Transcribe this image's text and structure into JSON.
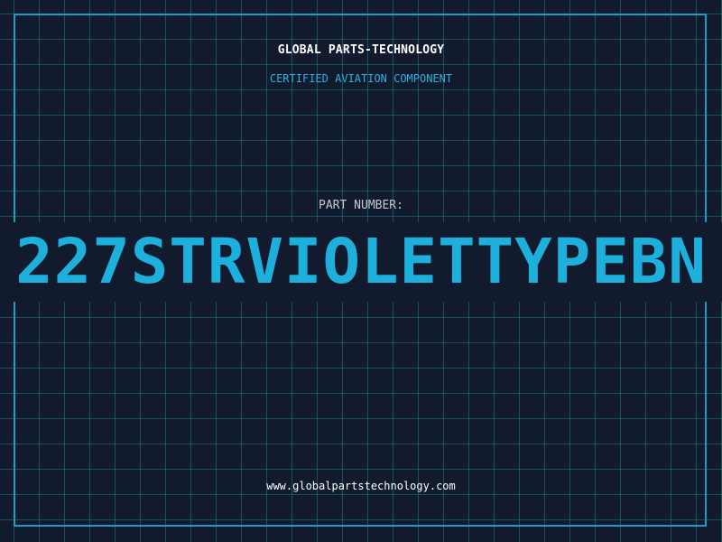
{
  "brand": "GLOBAL PARTS-TECHNOLOGY",
  "subtitle": "CERTIFIED AVIATION COMPONENT",
  "part_label": "PART NUMBER:",
  "part_number": "227STRVIOLETTYPEBN",
  "website": "www.globalpartstechnology.com",
  "colors": {
    "background": "#121a2e",
    "grid": "#1f6e85",
    "accent": "#1eb0dc",
    "frame": "#1f9cc4"
  }
}
